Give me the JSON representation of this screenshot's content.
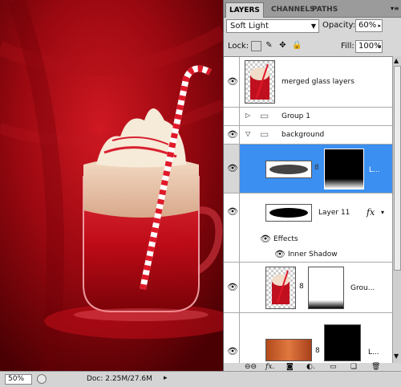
{
  "panel": {
    "tabs": [
      "LAYERS",
      "CHANNELS",
      "PATHS"
    ],
    "blend_mode": "Soft Light",
    "opacity_label": "Opacity:",
    "opacity": "60%",
    "lock_label": "Lock:",
    "fill_label": "Fill:",
    "fill": "100%"
  },
  "layers": [
    {
      "name": "merged glass layers"
    },
    {
      "name": "Group 1"
    },
    {
      "name": "background"
    },
    {
      "name": "L..."
    },
    {
      "name": "Layer 11",
      "fx": "fx"
    },
    {
      "name": "Effects"
    },
    {
      "name": "Inner Shadow"
    },
    {
      "name": "Grou..."
    },
    {
      "name": "L..."
    }
  ],
  "status": {
    "zoom": "50%",
    "doc": "Doc: 2.25M/27.6M"
  },
  "colors": {
    "selection": "#3b8ff0",
    "canvas_red": "#b80c14"
  },
  "icons": [
    "eye-icon",
    "folder-icon",
    "chain-link-icon",
    "fx-icon",
    "trash-icon",
    "new-layer-icon",
    "mask-icon",
    "adjustment-icon"
  ]
}
